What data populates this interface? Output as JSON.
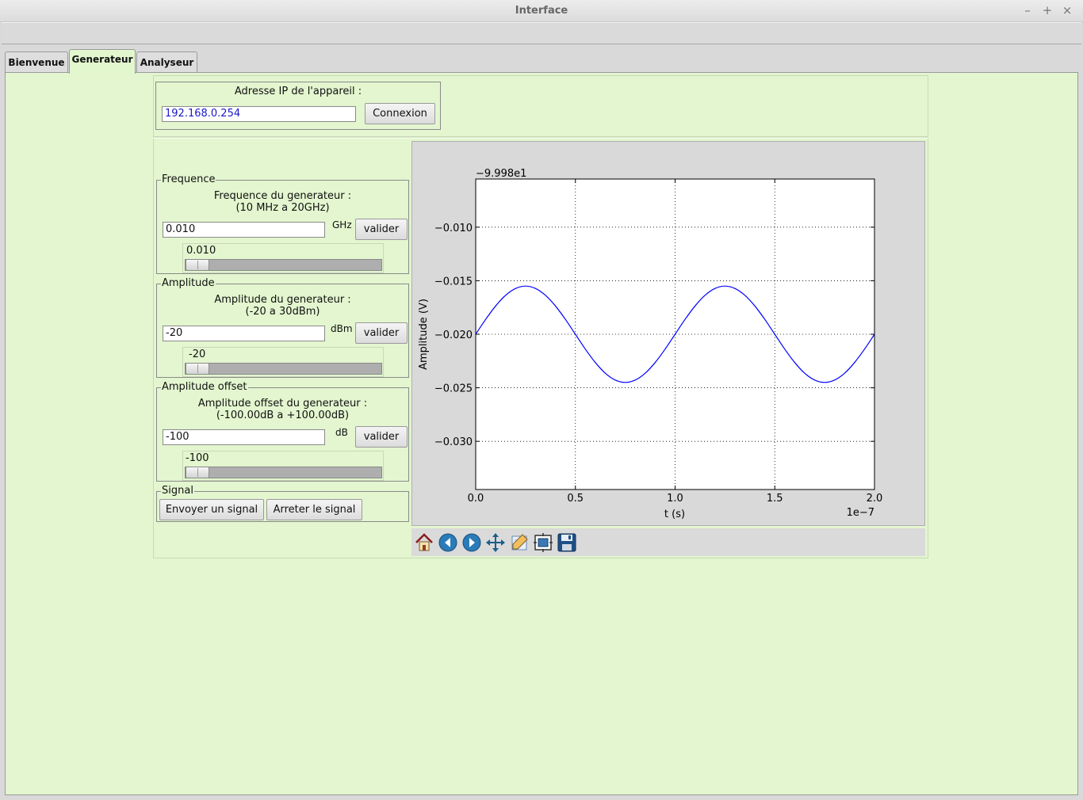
{
  "window": {
    "title": "Interface"
  },
  "tabs": [
    {
      "label": "Bienvenue",
      "active": false
    },
    {
      "label": "Generateur",
      "active": true
    },
    {
      "label": "Analyseur",
      "active": false
    }
  ],
  "connection": {
    "label": "Adresse IP de l'appareil :",
    "ip_value": "192.168.0.254",
    "button": "Connexion"
  },
  "frequence": {
    "group": "Frequence",
    "desc1": "Frequence du generateur :",
    "desc2": "(10 MHz a 20GHz)",
    "value": "0.010",
    "unit": "GHz",
    "button": "valider",
    "slider_label": "0.010",
    "slider_fraction": 0.0
  },
  "amplitude": {
    "group": "Amplitude",
    "desc1": "Amplitude du generateur :",
    "desc2": "(-20 a 30dBm)",
    "value": "-20",
    "unit": "dBm",
    "button": "valider",
    "slider_label": "-20",
    "slider_fraction": 0.0
  },
  "offset": {
    "group": "Amplitude offset",
    "desc1": "Amplitude offset du generateur :",
    "desc2": "(-100.00dB a +100.00dB)",
    "value": "-100",
    "unit": "dB",
    "button": "valider",
    "slider_label": "-100",
    "slider_fraction": 0.0
  },
  "signal": {
    "group": "Signal",
    "send": "Envoyer un signal",
    "stop": "Arreter le signal"
  },
  "chart_data": {
    "type": "line",
    "xlabel": "t (s)",
    "ylabel": "Amplitude (V)",
    "x_offset_label": "1e−7",
    "y_offset_label": "−9.998e1",
    "xlim": [
      0.0,
      2.0
    ],
    "ylim": [
      -0.0345,
      -0.0055
    ],
    "x_ticks": [
      "0.0",
      "0.5",
      "1.0",
      "1.5",
      "2.0"
    ],
    "y_ticks": [
      {
        "value": -0.01,
        "label": "−0.010"
      },
      {
        "value": -0.015,
        "label": "−0.015"
      },
      {
        "value": -0.02,
        "label": "−0.020"
      },
      {
        "value": -0.025,
        "label": "−0.025"
      },
      {
        "value": -0.03,
        "label": "−0.030"
      }
    ],
    "grid": true,
    "series": [
      {
        "color": "#0000ff",
        "x": [
          0.0,
          0.05,
          0.1,
          0.15,
          0.2,
          0.25,
          0.3,
          0.35,
          0.4,
          0.45,
          0.5,
          0.55,
          0.6,
          0.65,
          0.7,
          0.75,
          0.8,
          0.85,
          0.9,
          0.95,
          1.0,
          1.05,
          1.1,
          1.15,
          1.2,
          1.25,
          1.3,
          1.35,
          1.4,
          1.45,
          1.5,
          1.55,
          1.6,
          1.65,
          1.7,
          1.75,
          1.8,
          1.85,
          1.9,
          1.95,
          2.0
        ],
        "y": [
          -0.02,
          -0.01861,
          -0.01736,
          -0.01636,
          -0.01572,
          -0.0155,
          -0.01572,
          -0.01636,
          -0.01736,
          -0.01861,
          -0.02,
          -0.02139,
          -0.02264,
          -0.02364,
          -0.02428,
          -0.0245,
          -0.02428,
          -0.02364,
          -0.02264,
          -0.02139,
          -0.02,
          -0.01861,
          -0.01736,
          -0.01636,
          -0.01572,
          -0.0155,
          -0.01572,
          -0.01636,
          -0.01736,
          -0.01861,
          -0.02,
          -0.02139,
          -0.02264,
          -0.02364,
          -0.02428,
          -0.0245,
          -0.02428,
          -0.02364,
          -0.02264,
          -0.02139,
          -0.02
        ]
      }
    ]
  },
  "toolbar": {
    "icons": [
      "home-icon",
      "back-icon",
      "forward-icon",
      "pan-icon",
      "zoom-icon",
      "subplots-icon",
      "save-icon"
    ]
  }
}
